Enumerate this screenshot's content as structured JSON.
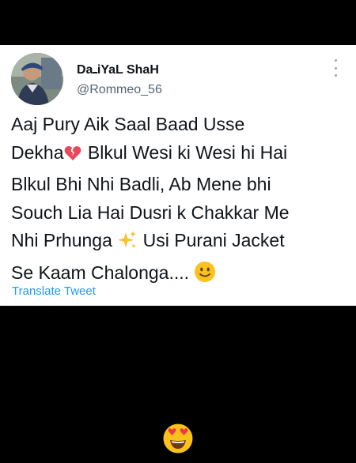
{
  "tweet": {
    "author": {
      "display_name": "DaـiYaL ShaH",
      "handle": "@Rommeo_56",
      "avatar_icon": "profile-photo"
    },
    "menu_icon": "more-vertical-icon",
    "text_lines": [
      "Aaj Pury Aik Saal Baad Usse",
      "Dekha",
      "Blkul Wesi ki Wesi hi Hai",
      "Blkul Bhi Nhi Badli, Ab Mene bhi",
      "Souch Lia Hai Dusri k Chakkar Me",
      "Nhi Prhunga",
      "Usi Purani Jacket",
      "Se Kaam Chalonga...."
    ],
    "emojis": {
      "broken_heart": "broken-heart-icon",
      "sparkles": "sparkles-icon",
      "smile": "slightly-smiling-face-icon"
    },
    "translate_label": "Translate Tweet"
  },
  "reaction_emoji": "heart-eyes-face-icon",
  "colors": {
    "background": "#000000",
    "card": "#ffffff",
    "text": "#0f1419",
    "handle": "#536471",
    "link": "#1d9bf0"
  }
}
